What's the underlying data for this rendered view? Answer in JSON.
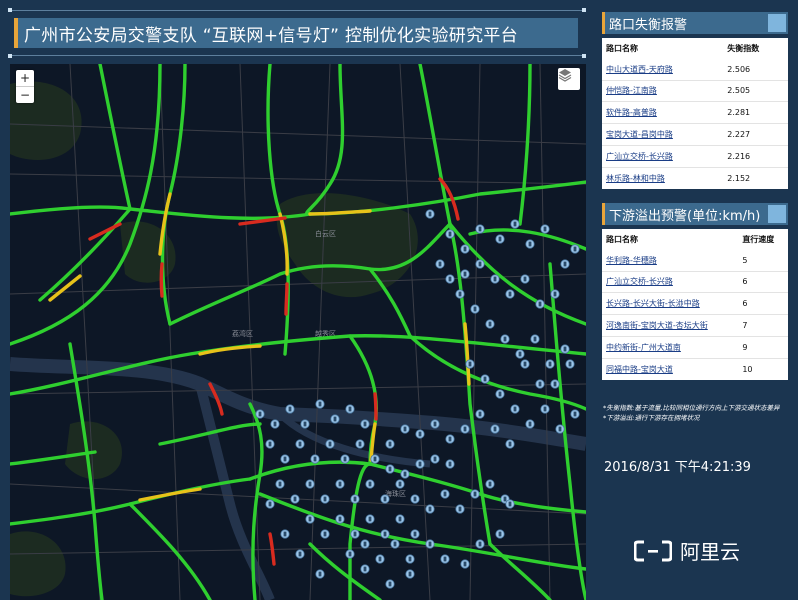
{
  "header": {
    "title": "广州市公安局交警支队 “互联网+信号灯” 控制优化实验研究平台"
  },
  "map": {
    "zoom_in": "+",
    "zoom_out": "−",
    "layers_icon": "layers-icon",
    "labels": [
      "白云区",
      "荔湾区",
      "越秀区",
      "海珠区"
    ],
    "colors": {
      "background": "#0d1726",
      "free_flow": "#2fcf2f",
      "slow": "#e7c21a",
      "congested": "#d82b1f",
      "signal_marker": "#9ec7ea"
    }
  },
  "imbalance_panel": {
    "title": "路口失衡报警",
    "col_name": "路口名称",
    "col_value": "失衡指数",
    "rows": [
      {
        "name": "中山大道西-天府路",
        "value": "2.506"
      },
      {
        "name": "仲恺路-江南路",
        "value": "2.505"
      },
      {
        "name": "软件路-高普路",
        "value": "2.281"
      },
      {
        "name": "宝岗大道-昌岗中路",
        "value": "2.227"
      },
      {
        "name": "广汕立交桥-长兴路",
        "value": "2.216"
      },
      {
        "name": "林乐路-林和中路",
        "value": "2.152"
      }
    ]
  },
  "overflow_panel": {
    "title": "下游溢出预警(单位:km/h)",
    "col_name": "路口名称",
    "col_value": "直行速度",
    "rows": [
      {
        "name": "华利路-华穗路",
        "value": "5"
      },
      {
        "name": "广汕立交桥-长兴路",
        "value": "6"
      },
      {
        "name": "长兴路-长兴大街-长湴中路",
        "value": "6"
      },
      {
        "name": "河逸南街-宝岗大道-杏坛大街",
        "value": "7"
      },
      {
        "name": "中约新街-广州大道南",
        "value": "9"
      },
      {
        "name": "同福中路-宝岗大道",
        "value": "10"
      }
    ]
  },
  "notes": {
    "line1": "*失衡指数:基于流量,比较同相位通行方向上下游交通状态差异",
    "line2": "*下游溢出:通行下游存在拥堵状况"
  },
  "clock": "2016/8/31 下午4:21:39",
  "brand": {
    "name": "阿里云",
    "logo_icon": "aliyun-logo-icon"
  },
  "colors": {
    "page_bg": "#1b3550",
    "header_bg": "#3c6a8e",
    "accent": "#e9a53a"
  }
}
